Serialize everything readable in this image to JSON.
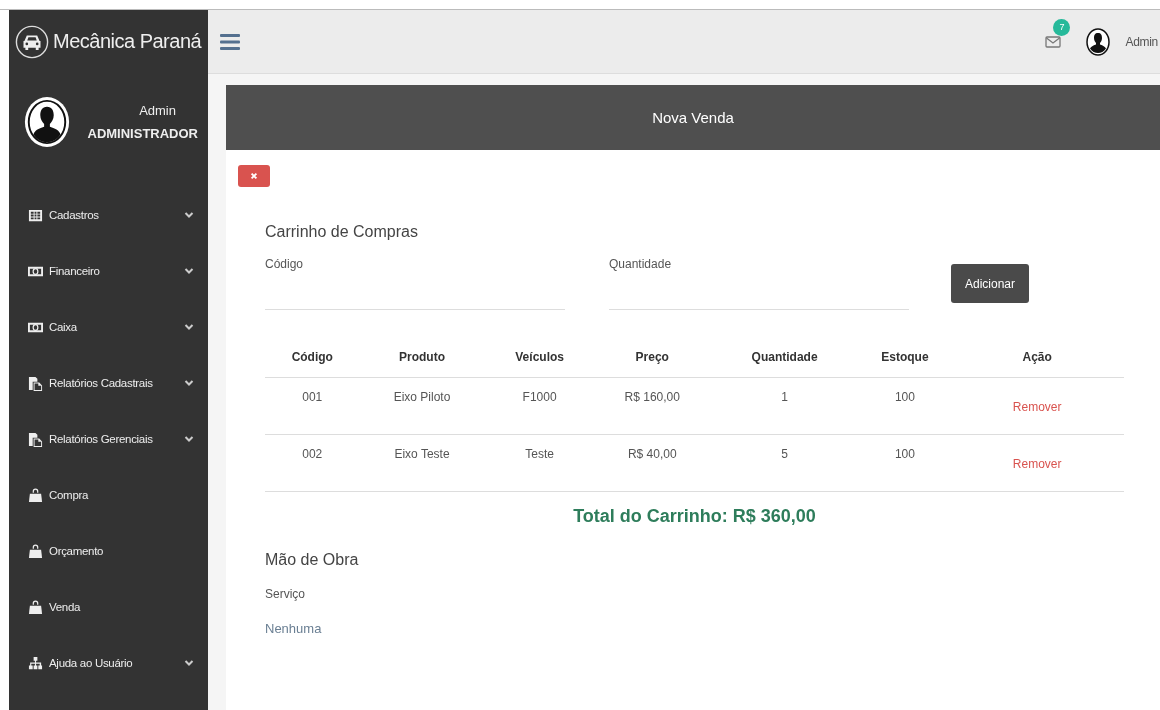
{
  "brand": {
    "title": "Mecânica Paraná"
  },
  "navbar": {
    "message_count": "7",
    "user": "Admin"
  },
  "sidebar": {
    "user": {
      "name": "Admin",
      "role": "ADMINISTRADOR"
    },
    "items": [
      {
        "label": "Cadastros",
        "kind": "table",
        "has_submenu": true
      },
      {
        "label": "Financeiro",
        "kind": "money",
        "has_submenu": true
      },
      {
        "label": "Caixa",
        "kind": "money",
        "has_submenu": true
      },
      {
        "label": "Relatórios Cadastrais",
        "kind": "report",
        "has_submenu": true
      },
      {
        "label": "Relatórios Gerenciais",
        "kind": "report",
        "has_submenu": true
      },
      {
        "label": "Compra",
        "kind": "bag",
        "has_submenu": false
      },
      {
        "label": "Orçamento",
        "kind": "bag",
        "has_submenu": false
      },
      {
        "label": "Venda",
        "kind": "bag",
        "has_submenu": false
      },
      {
        "label": "Ajuda ao Usuário",
        "kind": "sitemap",
        "has_submenu": true
      }
    ]
  },
  "panel": {
    "title": "Nova Venda"
  },
  "cart": {
    "title": "Carrinho de Compras",
    "fields": [
      {
        "label": "Código"
      },
      {
        "label": "Quantidade"
      }
    ],
    "add_button": "Adicionar",
    "columns": [
      "Código",
      "Produto",
      "Veículos",
      "Preço",
      "Quantidade",
      "Estoque",
      "Ação"
    ],
    "rows": [
      {
        "cells": [
          "001",
          "Eixo Piloto",
          "F1000",
          "R$ 160,00",
          "1",
          "100"
        ],
        "action": "Remover"
      },
      {
        "cells": [
          "002",
          "Eixo Teste",
          "Teste",
          "R$ 40,00",
          "5",
          "100"
        ],
        "action": "Remover"
      }
    ],
    "total": "Total do Carrinho: R$ 360,00"
  },
  "labor": {
    "title": "Mão de Obra",
    "label": "Serviço",
    "value": "Nenhuma"
  }
}
